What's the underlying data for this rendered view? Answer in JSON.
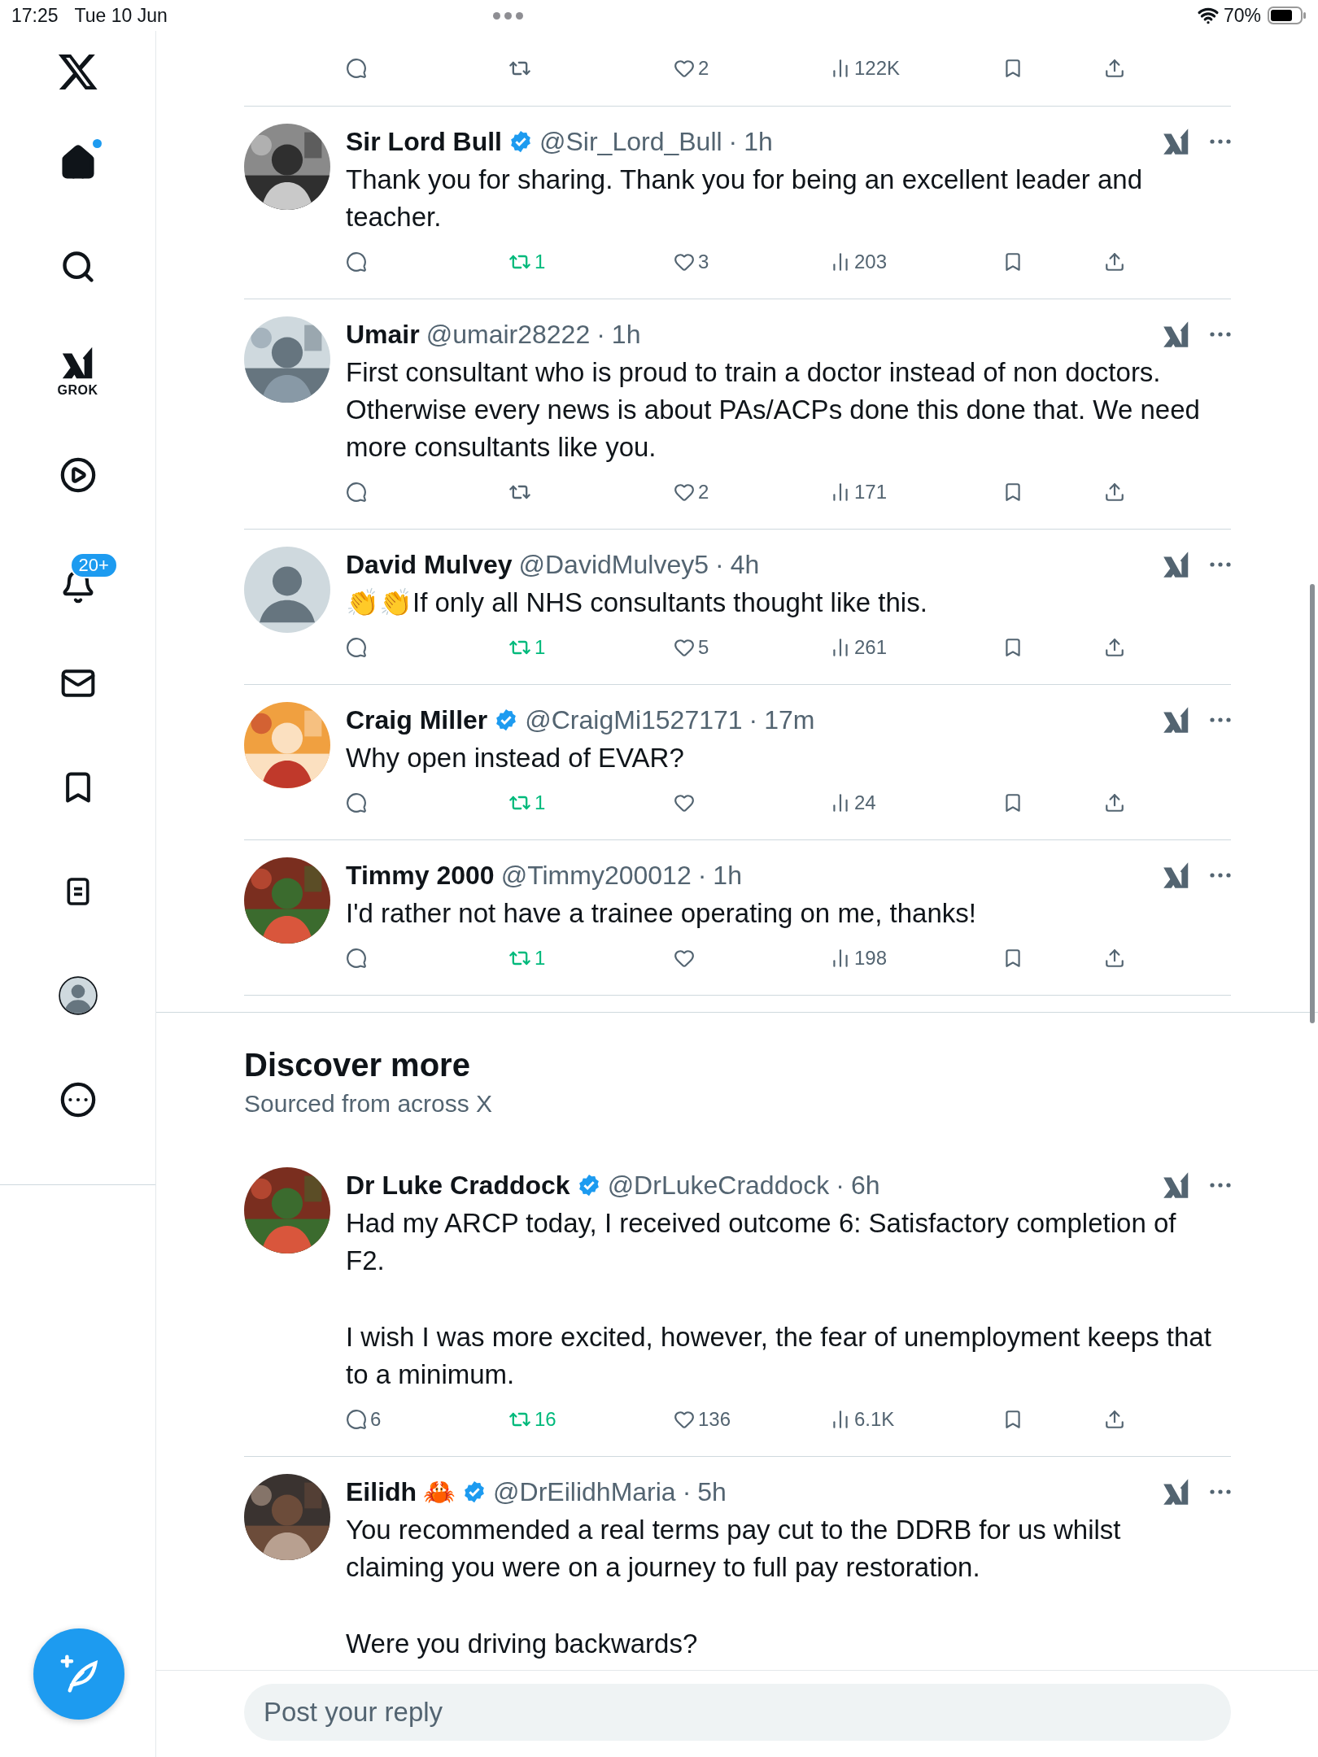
{
  "status_bar": {
    "time": "17:25",
    "date": "Tue 10 Jun",
    "battery": "70%"
  },
  "sidebar": {
    "items": [
      {
        "kind": "home",
        "selected": true,
        "unread_dot": true
      },
      {
        "kind": "search",
        "selected": false
      },
      {
        "kind": "grok",
        "label": "GROK",
        "selected": false
      },
      {
        "kind": "video",
        "selected": false
      },
      {
        "kind": "notifications",
        "badge": "20+",
        "selected": false
      },
      {
        "kind": "messages",
        "selected": false
      },
      {
        "kind": "bookmarks",
        "selected": false
      },
      {
        "kind": "lists",
        "selected": false
      },
      {
        "kind": "profile",
        "selected": false
      },
      {
        "kind": "more",
        "selected": false
      }
    ]
  },
  "replies": [
    {
      "kind": "partial",
      "actions": {
        "retweeted": false,
        "likes": "2",
        "views": "122K"
      }
    },
    {
      "kind": "tweet",
      "name": "Sir Lord Bull",
      "verified": true,
      "handle": "@Sir_Lord_Bull",
      "separator": "·",
      "time": "1h",
      "avatar": {
        "kind": "picture"
      },
      "text": [
        "Thank you for sharing. Thank you for being an excellent leader and teacher."
      ],
      "actions": {
        "retweets": "1",
        "retweeted": true,
        "likes": "3",
        "views": "203"
      }
    },
    {
      "kind": "tweet",
      "name": "Umair",
      "verified": false,
      "handle": "@umair28222",
      "separator": "·",
      "time": "1h",
      "avatar": {
        "kind": "picture"
      },
      "text": [
        "First consultant who is proud to train a doctor instead of non doctors. Otherwise every news is about PAs/ACPs done this done that.  We need more consultants like you."
      ],
      "actions": {
        "retweeted": false,
        "likes": "2",
        "views": "171"
      }
    },
    {
      "kind": "tweet",
      "name": "David Mulvey",
      "verified": false,
      "handle": "@DavidMulvey5",
      "separator": "·",
      "time": "4h",
      "avatar": {
        "kind": "default"
      },
      "text": [
        "👏👏If only all NHS consultants thought like this."
      ],
      "actions": {
        "retweets": "1",
        "retweeted": true,
        "likes": "5",
        "views": "261"
      }
    },
    {
      "kind": "tweet",
      "name": "Craig Miller",
      "verified": true,
      "handle": "@CraigMi1527171",
      "separator": "·",
      "time": "17m",
      "avatar": {
        "kind": "picture"
      },
      "text": [
        "Why open instead of EVAR?"
      ],
      "actions": {
        "retweets": "1",
        "retweeted": true,
        "views": "24"
      }
    },
    {
      "kind": "tweet",
      "name": "Timmy 2000",
      "verified": false,
      "handle": "@Timmy200012",
      "separator": "·",
      "time": "1h",
      "avatar": {
        "kind": "picture"
      },
      "text": [
        "I'd rather not have a trainee operating on me, thanks!"
      ],
      "actions": {
        "retweets": "1",
        "retweeted": true,
        "views": "198"
      }
    }
  ],
  "discover": {
    "title": "Discover more",
    "subtitle": "Sourced from across X",
    "tweets": [
      {
        "kind": "tweet",
        "name": "Dr Luke Craddock",
        "verified": true,
        "handle": "@DrLukeCraddock",
        "separator": "·",
        "time": "6h",
        "avatar": {
          "kind": "picture"
        },
        "text": [
          "Had my ARCP today, I received outcome 6: Satisfactory completion of F2.",
          "I wish I was more excited, however, the fear of unemployment keeps that to a minimum."
        ],
        "actions": {
          "replies": "6",
          "retweets": "16",
          "retweeted": true,
          "likes": "136",
          "views": "6.1K"
        }
      },
      {
        "kind": "tweet",
        "name": "Eilidh",
        "name_emoji": "🦀",
        "verified": true,
        "handle": "@DrEilidhMaria",
        "separator": "·",
        "time": "5h",
        "avatar": {
          "kind": "picture"
        },
        "text": [
          "You recommended a real terms pay cut to the DDRB for us whilst claiming you were on a journey to full pay restoration.",
          "Were you driving backwards?"
        ]
      }
    ]
  },
  "reply_box": {
    "placeholder": "Post your reply"
  }
}
